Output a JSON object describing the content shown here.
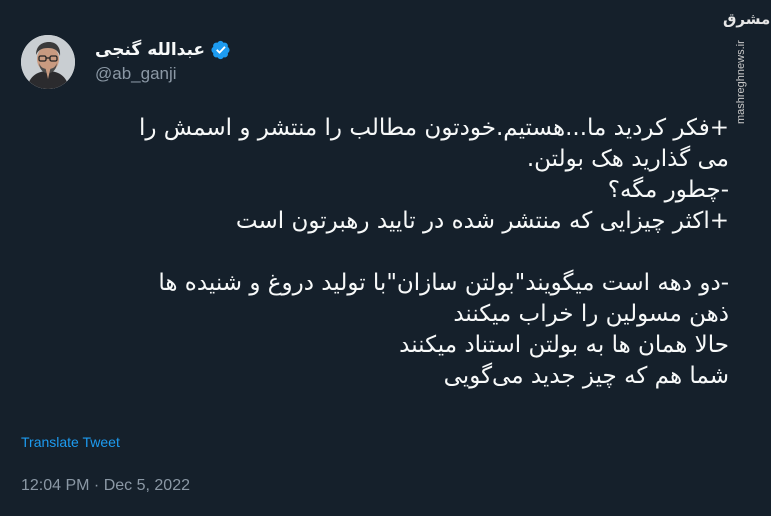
{
  "author": {
    "display_name": "عبدالله گنجی",
    "handle": "@ab_ganji",
    "verified": true,
    "avatar_icon": "person-with-glasses-avatar"
  },
  "watermark": {
    "logo": "مشرق",
    "url": "mashreghnews.ir"
  },
  "tweet_lines": [
    "+فکر کردید ما...هستیم.خودتون مطالب را منتشر و اسمش را",
    "می گذارید هک بولتن.",
    "-چطور مگه؟",
    "+اکثر چیزایی که منتشر شده در تایید رهبرتون است",
    "",
    "-دو دهه است میگویند\"بولتن سازان\"با تولید دروغ و شنیده ها",
    "ذهن مسولین را خراب میکنند",
    "حالا همان ها به بولتن استناد میکنند",
    "شما هم که چیز جدید می‌گویی"
  ],
  "translate_label": "Translate Tweet",
  "timestamp": "12:04 PM · Dec 5, 2022",
  "colors": {
    "background": "#15202b",
    "text": "#f7f9f9",
    "secondary": "#8b98a5",
    "accent": "#1d9bf0"
  }
}
